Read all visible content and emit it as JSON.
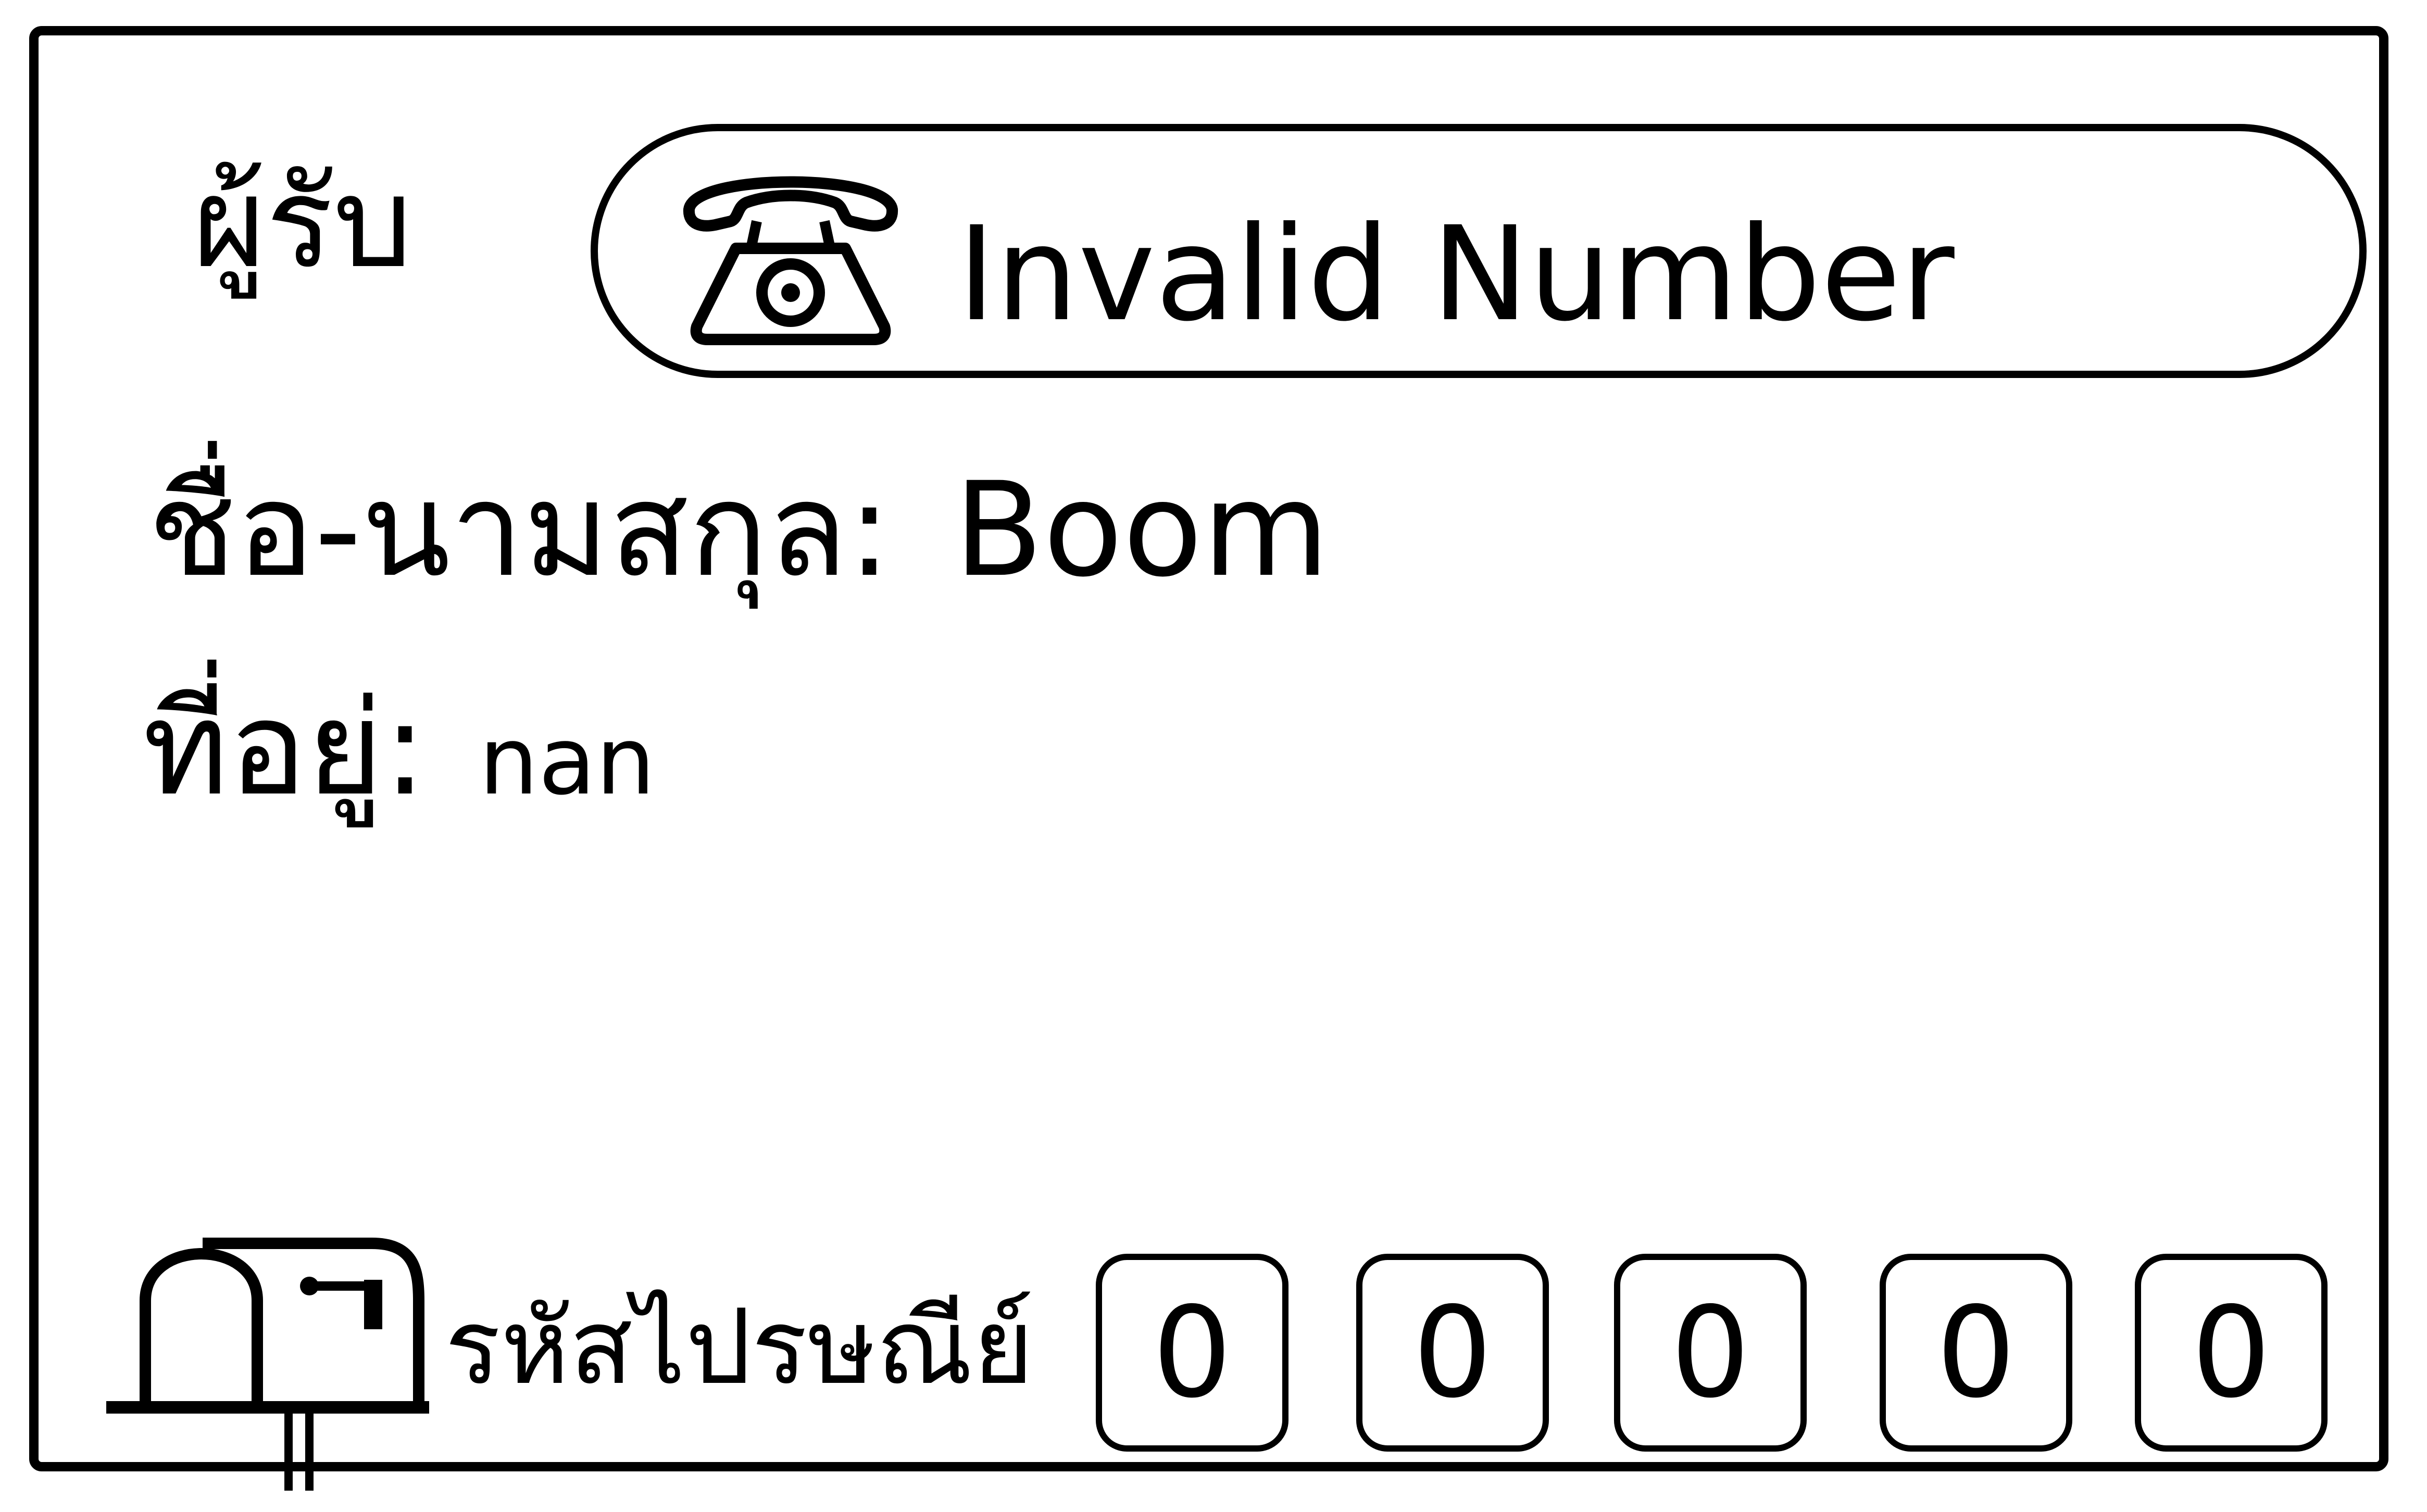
{
  "recipient": {
    "label": "ผู้รับ"
  },
  "phone": {
    "icon": "telephone-icon",
    "text": "Invalid Number"
  },
  "name": {
    "label": "ชื่อ-นามสกุล:",
    "value": "Boom"
  },
  "address": {
    "label": "ที่อยู่:",
    "value": "nan"
  },
  "postal": {
    "icon": "mailbox-icon",
    "label": "รหัสไปรษณีย์",
    "digits": [
      "0",
      "0",
      "0",
      "0",
      "0"
    ]
  }
}
